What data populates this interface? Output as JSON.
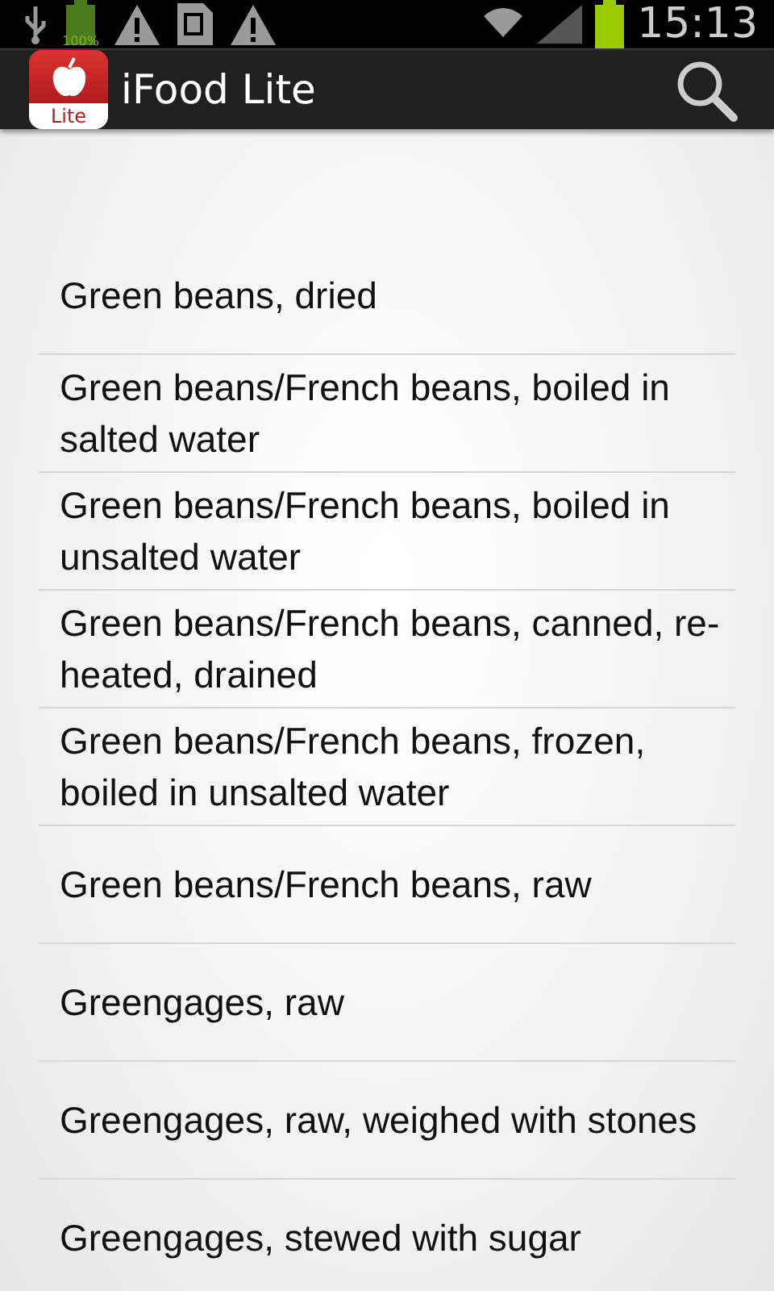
{
  "status_bar": {
    "battery_label": "100%",
    "time": "15:13"
  },
  "action_bar": {
    "icon_badge": "Lite",
    "title": "iFood Lite"
  },
  "items": [
    {
      "label": "Green beans, dried"
    },
    {
      "label": "Green beans/French beans, boiled in salted water"
    },
    {
      "label": "Green beans/French beans, boiled in unsalted water"
    },
    {
      "label": "Green beans/French beans, canned, re-heated, drained"
    },
    {
      "label": "Green beans/French beans, frozen, boiled in unsalted water"
    },
    {
      "label": "Green beans/French beans, raw"
    },
    {
      "label": "Greengages, raw"
    },
    {
      "label": "Greengages, raw, weighed with stones"
    },
    {
      "label": "Greengages, stewed with sugar"
    }
  ]
}
